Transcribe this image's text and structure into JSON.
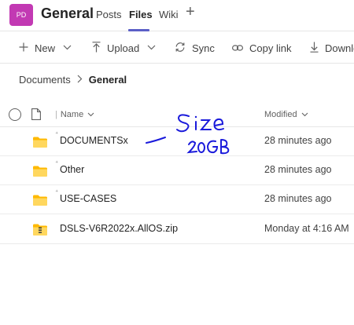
{
  "header": {
    "avatar_initials": "PD",
    "team_name": "General",
    "tabs": [
      {
        "label": "Posts",
        "active": false
      },
      {
        "label": "Files",
        "active": true
      },
      {
        "label": "Wiki",
        "active": false
      }
    ],
    "add_tab_icon": "plus-icon",
    "accent_color": "#5b5fc7",
    "avatar_color": "#c239b3"
  },
  "toolbar": {
    "new_label": "New",
    "upload_label": "Upload",
    "sync_label": "Sync",
    "copy_link_label": "Copy link",
    "download_label": "Downlo"
  },
  "breadcrumb": {
    "parent": "Documents",
    "current": "General"
  },
  "table": {
    "name_header": "Name",
    "modified_header": "Modified",
    "rows": [
      {
        "name": "DOCUMENTSx",
        "modified": "28 minutes ago",
        "type": "folder"
      },
      {
        "name": "Other",
        "modified": "28 minutes ago",
        "type": "folder"
      },
      {
        "name": "USE-CASES",
        "modified": "28 minutes ago",
        "type": "folder"
      },
      {
        "name": "DSLS-V6R2022x.AllOS.zip",
        "modified": "Monday at 4:16 AM",
        "type": "zip"
      }
    ]
  },
  "annotation": {
    "line1": "Size",
    "line2": "20GB",
    "color": "#1a1adb"
  }
}
